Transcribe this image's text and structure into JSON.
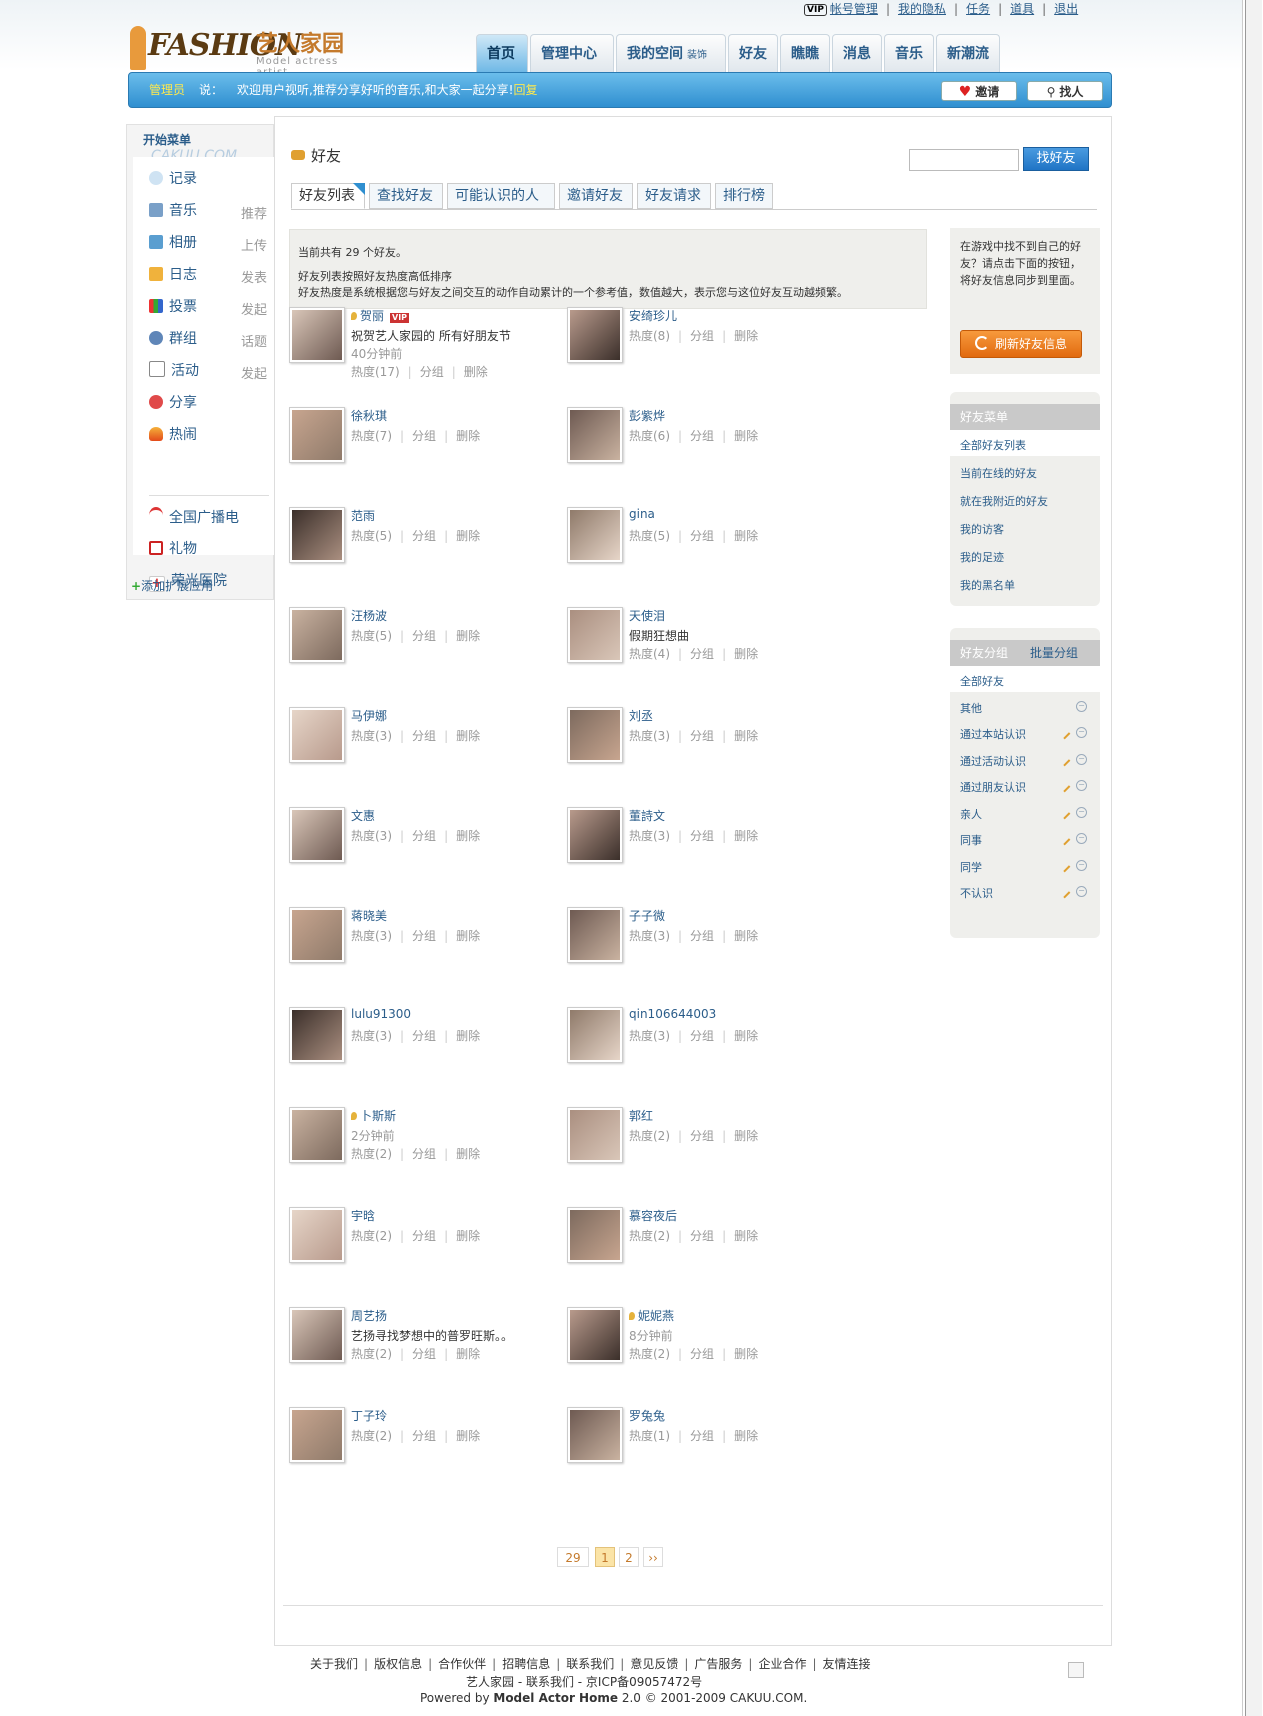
{
  "toplinks": {
    "vip": "VIP",
    "items": [
      "帐号管理",
      "我的隐私",
      "任务",
      "道具",
      "退出"
    ]
  },
  "logo": {
    "fashion": "FASHION",
    "cn": "艺人家园",
    "sub": "Model actress artist"
  },
  "nav": {
    "tabs": [
      "首页",
      "管理中心",
      "我的空间",
      "好友",
      "瞧瞧",
      "消息",
      "音乐",
      "新潮流"
    ],
    "decor": "装饰"
  },
  "bluebar": {
    "who": "管理员",
    "say": "说：",
    "message": "欢迎用户视听,推荐分享好听的音乐,和大家一起分享!",
    "reply": "回复",
    "invite": "邀请",
    "find": "找人"
  },
  "sidebar": {
    "head": "开始菜单",
    "brand": "CAKUU.COM",
    "items": [
      {
        "label": "记录",
        "aux": ""
      },
      {
        "label": "音乐",
        "aux": "推荐"
      },
      {
        "label": "相册",
        "aux": "上传"
      },
      {
        "label": "日志",
        "aux": "发表"
      },
      {
        "label": "投票",
        "aux": "发起"
      },
      {
        "label": "群组",
        "aux": "话题"
      },
      {
        "label": "活动",
        "aux": "发起"
      },
      {
        "label": "分享",
        "aux": ""
      },
      {
        "label": "热闹",
        "aux": ""
      }
    ],
    "apps": [
      "全国广播电",
      "礼物",
      "荣光医院"
    ],
    "add": "添加扩展应用"
  },
  "main": {
    "title": "好友",
    "search_btn": "找好友",
    "tabs": [
      "好友列表",
      "查找好友",
      "可能认识的人",
      "邀请好友",
      "好友请求",
      "排行榜"
    ],
    "info": {
      "l1": "当前共有  29 个好友。",
      "l2": "好友列表按照好友热度高低排序",
      "l3": "好友热度是系统根据您与好友之间交互的动作自动累计的一个参考值，数值越大，表示您与这位好友互动越频繁。"
    },
    "ops": {
      "group": "分组",
      "delete": "删除"
    }
  },
  "friends": [
    {
      "name": "贺丽",
      "loc": true,
      "vip": true,
      "status": "祝贺艺人家园的 所有好朋友节",
      "ago": "40分钟前",
      "heat": "热度(17)"
    },
    {
      "name": "安绮珍儿",
      "heat": "热度(8)"
    },
    {
      "name": "徐秋琪",
      "heat": "热度(7)"
    },
    {
      "name": "彭紫烨",
      "heat": "热度(6)"
    },
    {
      "name": "范雨",
      "heat": "热度(5)"
    },
    {
      "name": "gina",
      "heat": "热度(5)"
    },
    {
      "name": "汪杨波",
      "heat": "热度(5)"
    },
    {
      "name": "天使泪",
      "status": "假期狂想曲",
      "heat": "热度(4)"
    },
    {
      "name": "马伊娜",
      "heat": "热度(3)"
    },
    {
      "name": "刘丞",
      "heat": "热度(3)"
    },
    {
      "name": "文惠",
      "heat": "热度(3)"
    },
    {
      "name": "董詩文",
      "heat": "热度(3)"
    },
    {
      "name": "蒋晓美",
      "heat": "热度(3)"
    },
    {
      "name": "子子微",
      "heat": "热度(3)"
    },
    {
      "name": "lulu91300",
      "heat": "热度(3)"
    },
    {
      "name": "qin106644003",
      "heat": "热度(3)"
    },
    {
      "name": "卜斯斯",
      "loc": true,
      "ago": "2分钟前",
      "heat": "热度(2)"
    },
    {
      "name": "郭红",
      "heat": "热度(2)"
    },
    {
      "name": "宇晗",
      "heat": "热度(2)"
    },
    {
      "name": "慕容夜后",
      "heat": "热度(2)"
    },
    {
      "name": "周艺扬",
      "status": "艺扬寻找梦想中的普罗旺斯。。",
      "heat": "热度(2)"
    },
    {
      "name": "妮妮燕",
      "loc": true,
      "ago": "8分钟前",
      "heat": "热度(2)"
    },
    {
      "name": "丁子玲",
      "heat": "热度(2)"
    },
    {
      "name": "罗兔兔",
      "heat": "热度(1)"
    }
  ],
  "pager": {
    "total": "29",
    "pages": [
      "1",
      "2"
    ],
    "next": "››",
    "current": "1"
  },
  "right": {
    "sync_text": "在游戏中找不到自己的好友？请点击下面的按钮，将好友信息同步到里面。",
    "sync_btn": "刷新好友信息",
    "menu_title": "好友菜单",
    "menu": [
      "全部好友列表",
      "当前在线的好友",
      "就在我附近的好友",
      "我的访客",
      "我的足迹",
      "我的黑名单"
    ],
    "group_title": "好友分组",
    "batch": "批量分组",
    "groups": [
      "全部好友",
      "其他",
      "通过本站认识",
      "通过活动认识",
      "通过朋友认识",
      "亲人",
      "同事",
      "同学",
      "不认识"
    ]
  },
  "footer": {
    "links": [
      "关于我们",
      "版权信息",
      "合作伙伴",
      "招聘信息",
      "联系我们",
      "意见反馈",
      "广告服务",
      "企业合作",
      "友情连接"
    ],
    "line2": "艺人家园 - 联系我们 - 京ICP备09057472号",
    "powered_prefix": "Powered by ",
    "powered_name": "Model Actor Home",
    "powered_suffix": " 2.0 © 2001-2009 CAKUU.COM."
  }
}
